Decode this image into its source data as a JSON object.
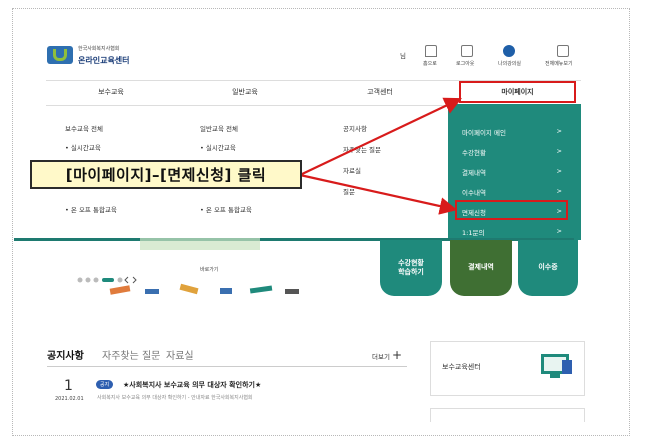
{
  "header": {
    "logo_small_text": "한국사회복지사협회",
    "logo_main_text": "온라인교육센터",
    "util_icons": [
      {
        "name": "home-icon",
        "label": "홈으로"
      },
      {
        "name": "logout-icon",
        "label": "로그아웃"
      },
      {
        "name": "myclass-icon",
        "label": "나의강의실"
      },
      {
        "name": "sitemap-icon",
        "label": "전체메뉴보기"
      }
    ]
  },
  "gnb": {
    "items": [
      "보수교육",
      "일반교육",
      "고객센터",
      "마이페이지"
    ]
  },
  "dropdown": {
    "col1": {
      "title": "보수교육 전체",
      "items": [
        "실시간교육",
        "온 오프 통합교육"
      ]
    },
    "col2": {
      "title": "일반교육 전체",
      "items": [
        "실시간교육",
        "온 오프 통합교육"
      ]
    },
    "col3": {
      "items": [
        "공지사항",
        "자주찾는 질문",
        "자료실",
        "질문"
      ]
    },
    "mypage": [
      "마이페이지 메인",
      "수강현황",
      "결제내역",
      "이수내역",
      "면제신청",
      "1:1문의"
    ],
    "arrow": ">"
  },
  "callout": {
    "text": "[마이페이지]–[면제신청] 클릭"
  },
  "hero": {
    "tiles": [
      "수강현황\n학습하기",
      "결제내역",
      "이수증"
    ],
    "more_link": "바로가기"
  },
  "notice": {
    "tabs": [
      "공지사항",
      "자주찾는 질문",
      "자료실"
    ],
    "more_label": "더보기",
    "item": {
      "day": "1",
      "date": "2021.02.01",
      "badge": "공지",
      "title": "★사회복지사 보수교육 의무 대상자 확인하기★",
      "summary": "사회복지사 보수교육 의무 대상자 확인하기 - 안내자료 한국사회복지사협회"
    }
  },
  "side": {
    "title": "보수교육센터"
  },
  "colors": {
    "accent": "#1f8a7c",
    "highlight": "#d81b1b",
    "callout_bg": "#fff9c9",
    "tile_green": "#3f6f33"
  }
}
